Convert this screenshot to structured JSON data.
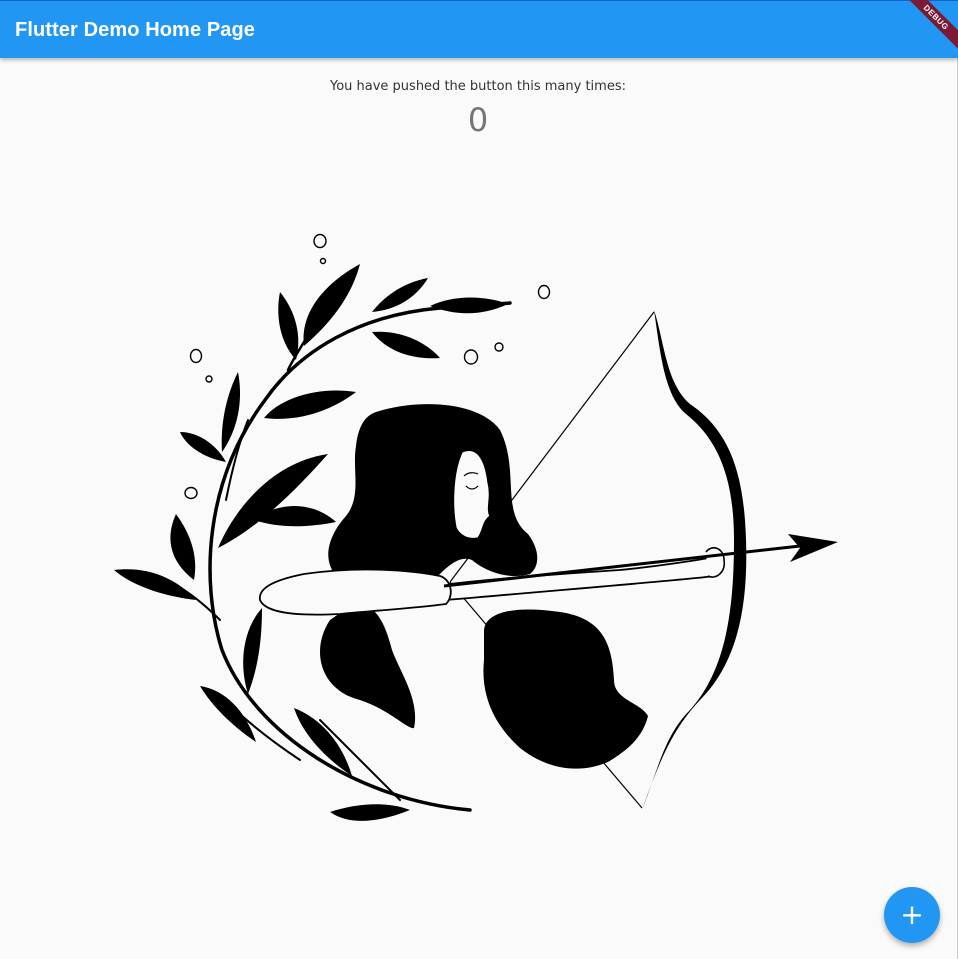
{
  "appbar": {
    "title": "Flutter Demo Home Page",
    "color": "#2196f3"
  },
  "debug_banner": {
    "label": "DEBUG",
    "color": "#7a1a35"
  },
  "main": {
    "message": "You have pushed the button this many times:",
    "counter": "0",
    "illustration_icon": "archer-woman-icon"
  },
  "fab": {
    "icon": "add-icon",
    "symbol": "+",
    "color": "#2196f3"
  }
}
